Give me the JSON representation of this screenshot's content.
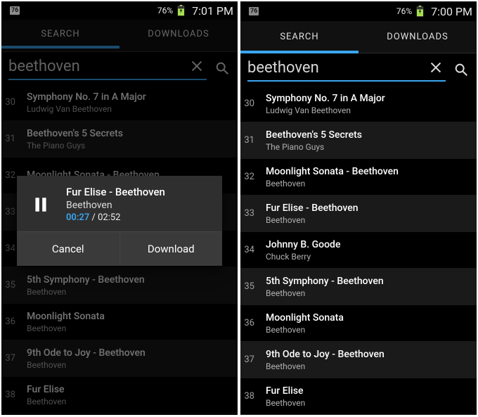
{
  "left": {
    "status": {
      "badge": "76",
      "battery_pct": "76%",
      "time": "7:01 PM"
    },
    "tabs": {
      "search": "SEARCH",
      "downloads": "DOWNLOADS"
    },
    "search": {
      "query": "beethoven"
    },
    "results": [
      {
        "n": "30",
        "title": "Symphony No. 7 in A Major",
        "artist": "Ludwig Van Beethoven"
      },
      {
        "n": "31",
        "title": "Beethoven's 5 Secrets",
        "artist": "The Piano Guys"
      },
      {
        "n": "32",
        "title": "Moonlight Sonata - Beethoven",
        "artist": ""
      },
      {
        "n": "33",
        "title": "",
        "artist": ""
      },
      {
        "n": "34",
        "title": "",
        "artist": ""
      },
      {
        "n": "35",
        "title": "5th Symphony - Beethoven",
        "artist": "Beethoven"
      },
      {
        "n": "36",
        "title": "Moonlight Sonata",
        "artist": "Beethoven"
      },
      {
        "n": "37",
        "title": "9th Ode to Joy - Beethoven",
        "artist": "Beethoven"
      },
      {
        "n": "38",
        "title": "Fur Elise",
        "artist": "Beethoven"
      }
    ],
    "dialog": {
      "title": "Fur Elise - Beethoven",
      "artist": "Beethoven",
      "elapsed": "00:27",
      "sep": " / ",
      "total": "02:52",
      "cancel": "Cancel",
      "download": "Download"
    }
  },
  "right": {
    "status": {
      "badge": "76",
      "battery_pct": "76%",
      "time": "7:00 PM"
    },
    "tabs": {
      "search": "SEARCH",
      "downloads": "DOWNLOADS"
    },
    "search": {
      "query": "beethoven"
    },
    "results": [
      {
        "n": "30",
        "title": "Symphony No. 7 in A Major",
        "artist": "Ludwig Van Beethoven"
      },
      {
        "n": "31",
        "title": "Beethoven's 5 Secrets",
        "artist": "The Piano Guys"
      },
      {
        "n": "32",
        "title": "Moonlight Sonata - Beethoven",
        "artist": "Beethoven"
      },
      {
        "n": "33",
        "title": "Fur Elise - Beethoven",
        "artist": "Beethoven"
      },
      {
        "n": "34",
        "title": "Johnny B. Goode",
        "artist": "Chuck Berry"
      },
      {
        "n": "35",
        "title": "5th Symphony - Beethoven",
        "artist": "Beethoven"
      },
      {
        "n": "36",
        "title": "Moonlight Sonata",
        "artist": "Beethoven"
      },
      {
        "n": "37",
        "title": "9th Ode to Joy - Beethoven",
        "artist": "Beethoven"
      },
      {
        "n": "38",
        "title": "Fur Elise",
        "artist": "Beethoven"
      }
    ]
  }
}
